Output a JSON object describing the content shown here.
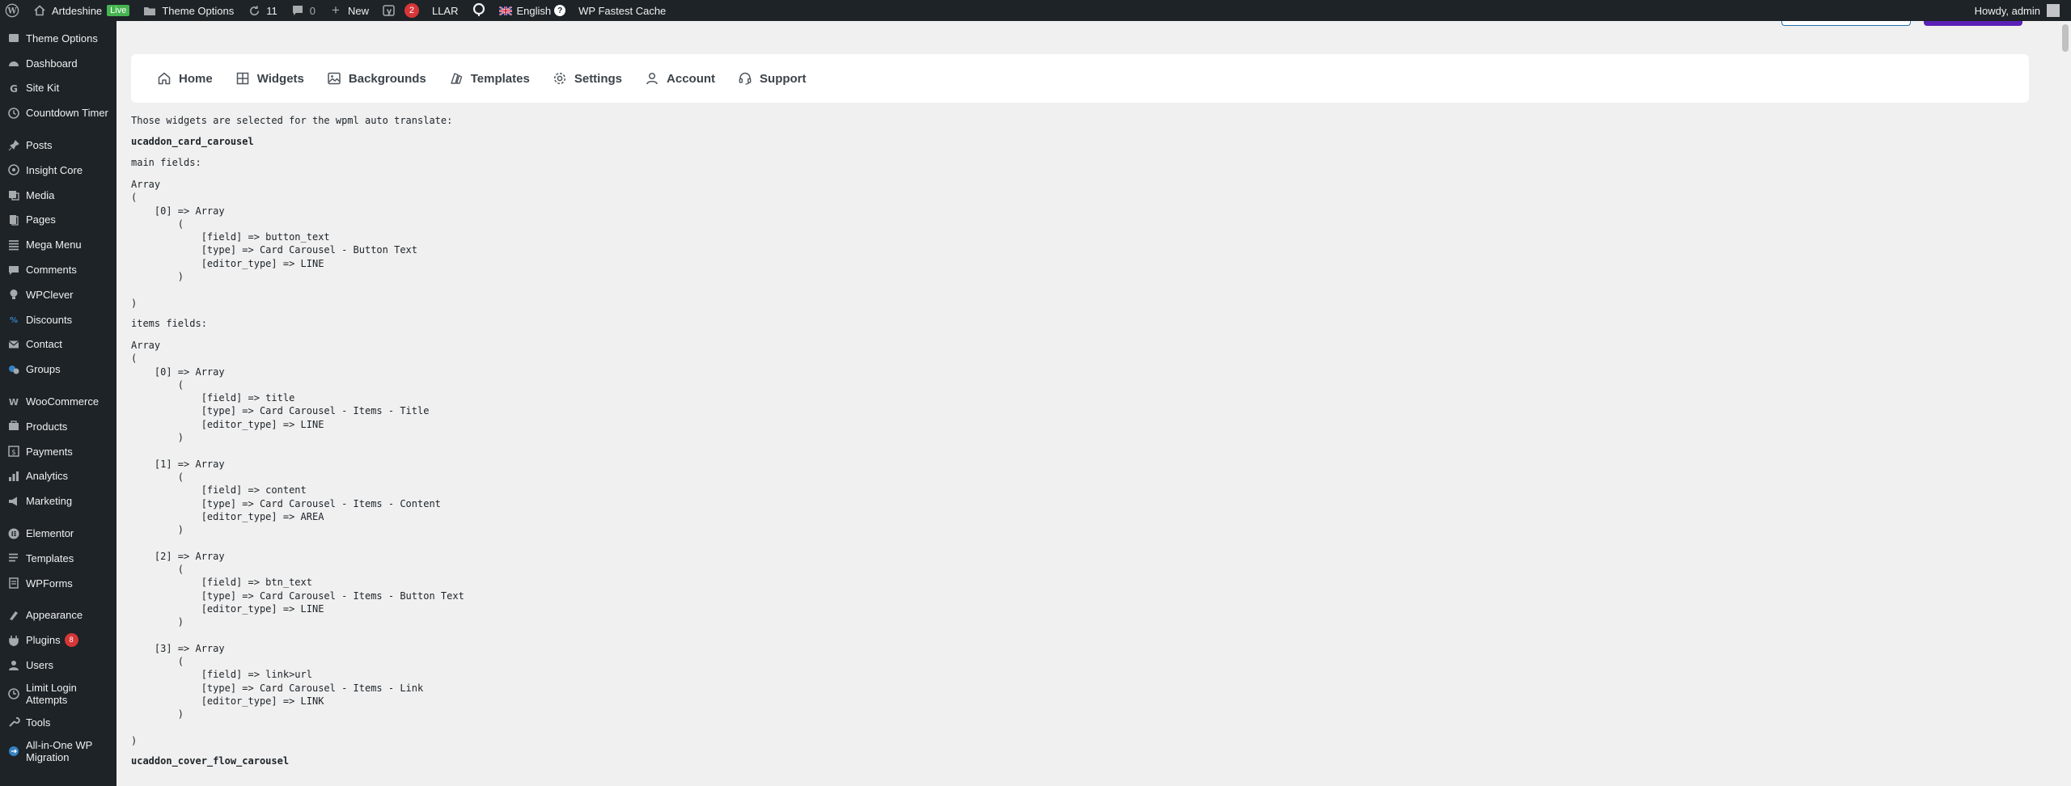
{
  "adminbar": {
    "site_name": "Artdeshine",
    "live_badge": "Live",
    "theme_options": "Theme Options",
    "updates_count": "11",
    "comments_count": "0",
    "new_label": "New",
    "yoast_count": "2",
    "llar_label": "LLAR",
    "language": "English",
    "language_help": "?",
    "cache_label": "WP Fastest Cache",
    "howdy": "Howdy, admin"
  },
  "sidebar": {
    "items": [
      {
        "label": "Theme Options",
        "icon": "theme-icon"
      },
      {
        "label": "Dashboard",
        "icon": "dashboard-icon"
      },
      {
        "label": "Site Kit",
        "icon": "sitekit-icon"
      },
      {
        "label": "Countdown Timer",
        "icon": "clock-icon"
      },
      {
        "label": "Posts",
        "icon": "pin-icon"
      },
      {
        "label": "Insight Core",
        "icon": "insight-icon"
      },
      {
        "label": "Media",
        "icon": "media-icon"
      },
      {
        "label": "Pages",
        "icon": "pages-icon"
      },
      {
        "label": "Mega Menu",
        "icon": "megamenu-icon"
      },
      {
        "label": "Comments",
        "icon": "comments-icon"
      },
      {
        "label": "WPClever",
        "icon": "bulb-icon"
      },
      {
        "label": "Discounts",
        "icon": "discount-icon"
      },
      {
        "label": "Contact",
        "icon": "mail-icon"
      },
      {
        "label": "Groups",
        "icon": "groups-icon"
      },
      {
        "label": "WooCommerce",
        "icon": "woo-icon"
      },
      {
        "label": "Products",
        "icon": "products-icon"
      },
      {
        "label": "Payments",
        "icon": "payments-icon"
      },
      {
        "label": "Analytics",
        "icon": "analytics-icon"
      },
      {
        "label": "Marketing",
        "icon": "marketing-icon"
      },
      {
        "label": "Elementor",
        "icon": "elementor-icon"
      },
      {
        "label": "Templates",
        "icon": "templates-icon"
      },
      {
        "label": "WPForms",
        "icon": "wpforms-icon"
      },
      {
        "label": "Appearance",
        "icon": "appearance-icon"
      },
      {
        "label": "Plugins",
        "icon": "plugins-icon",
        "count": "8"
      },
      {
        "label": "Users",
        "icon": "users-icon"
      },
      {
        "label": "Limit Login Attempts",
        "icon": "limit-login-icon"
      },
      {
        "label": "Tools",
        "icon": "tools-icon"
      },
      {
        "label": "All-in-One WP Migration",
        "icon": "migration-icon"
      }
    ]
  },
  "nav": {
    "items": [
      "Home",
      "Widgets",
      "Backgrounds",
      "Templates",
      "Settings",
      "Account",
      "Support"
    ]
  },
  "content": {
    "intro": "Those widgets are selected for the wpml auto translate:",
    "widget1": "ucaddon_card_carousel",
    "main_fields_label": "main fields:",
    "main_fields_dump": "Array\n(\n    [0] => Array\n        (\n            [field] => button_text\n            [type] => Card Carousel - Button Text\n            [editor_type] => LINE\n        )\n\n)",
    "items_fields_label": "items fields:",
    "items_fields_dump": "Array\n(\n    [0] => Array\n        (\n            [field] => title\n            [type] => Card Carousel - Items - Title\n            [editor_type] => LINE\n        )\n\n    [1] => Array\n        (\n            [field] => content\n            [type] => Card Carousel - Items - Content\n            [editor_type] => AREA\n        )\n\n    [2] => Array\n        (\n            [field] => btn_text\n            [type] => Card Carousel - Items - Button Text\n            [editor_type] => LINE\n        )\n\n    [3] => Array\n        (\n            [field] => link>url\n            [type] => Card Carousel - Items - Link\n            [editor_type] => LINK\n        )\n\n)",
    "widget2": "ucaddon_cover_flow_carousel"
  }
}
